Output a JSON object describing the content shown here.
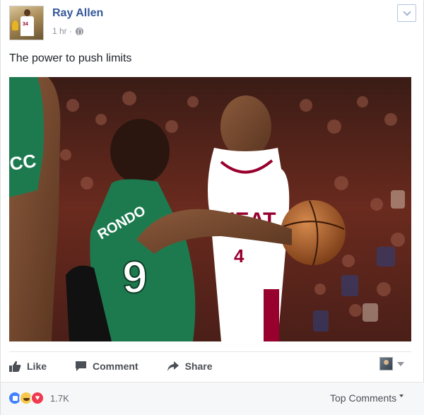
{
  "post": {
    "author": "Ray Allen",
    "time": "1 hr",
    "separator": "·",
    "privacy_icon": "globe-icon",
    "text": "The power to push limits",
    "photo": {
      "left_jersey_text": "CC",
      "green_jersey_name": "RONDO",
      "green_jersey_number": "9",
      "white_jersey_name": "HEAT",
      "white_jersey_number": "4"
    }
  },
  "actions": {
    "like": "Like",
    "comment": "Comment",
    "share": "Share"
  },
  "footer": {
    "reaction_icons": [
      "like-reaction-icon",
      "haha-reaction-icon",
      "love-reaction-icon"
    ],
    "reaction_count": "1.7K",
    "sort_label": "Top Comments"
  },
  "colors": {
    "author_link": "#365899",
    "meta_text": "#90949c",
    "action_text": "#4b4f56",
    "footer_bg": "#f6f7f9",
    "celtics_green": "#1d7a4f",
    "heat_red": "#98002e"
  }
}
